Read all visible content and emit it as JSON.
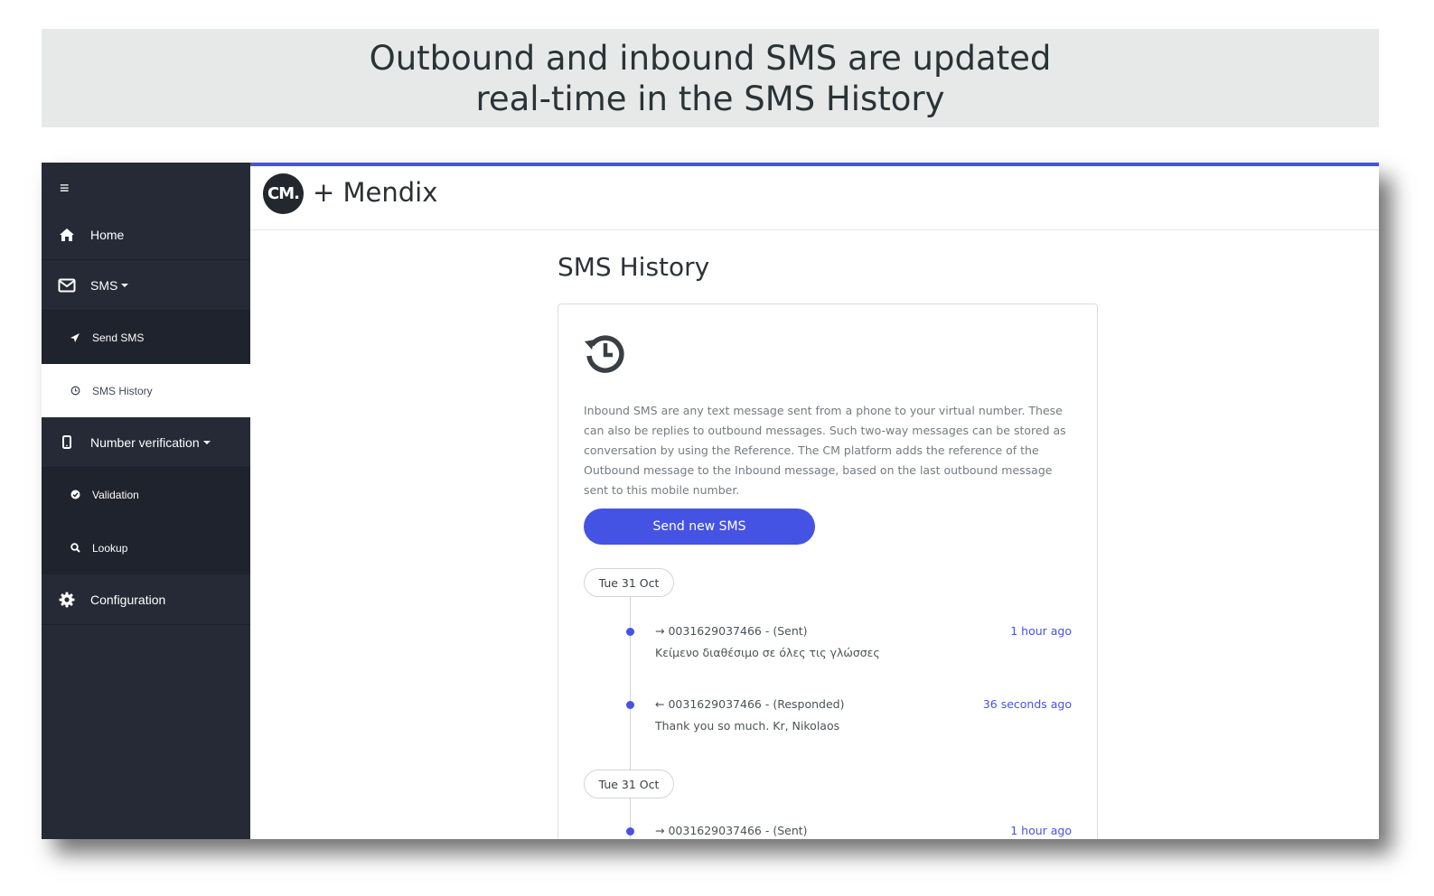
{
  "banner": {
    "line1": "Outbound and inbound SMS are updated",
    "line2": "real-time in the SMS History"
  },
  "colors": {
    "accent": "#4553e4",
    "sidebar_bg": "#252a36",
    "submenu_bg": "#1f232d",
    "link": "#4553e4"
  },
  "sidebar": {
    "menu_icon": "hamburger-icon",
    "items": [
      {
        "label": "Home",
        "icon": "home-icon"
      },
      {
        "label": "SMS",
        "icon": "envelope-icon"
      },
      {
        "label": "Send SMS",
        "icon": "send-icon"
      },
      {
        "label": "SMS History",
        "icon": "clock-icon"
      },
      {
        "label": "Number verification",
        "icon": "mobile-icon"
      },
      {
        "label": "Validation",
        "icon": "check-circle-icon"
      },
      {
        "label": "Lookup",
        "icon": "search-icon"
      },
      {
        "label": "Configuration",
        "icon": "gear-icon"
      }
    ]
  },
  "header": {
    "logo_text": "CM.",
    "brand": "+ Mendix"
  },
  "page": {
    "title": "SMS History",
    "description": "Inbound SMS are any text message sent from a phone to your virtual number. These can also be replies to outbound messages. Such two-way messages can be stored as conversation by using the Reference. The CM platform adds the reference of the Outbound message to the Inbound message, based on the last outbound message sent to this mobile number.",
    "button_label": "Send new SMS",
    "groups": [
      {
        "date": "Tue 31 Oct",
        "entries": [
          {
            "direction": "→",
            "header": "0031629037466 - (Sent)",
            "time": "1 hour ago",
            "message": "Κείμενο διαθέσιμο σε όλες τις γλώσσες"
          },
          {
            "direction": "←",
            "header": "0031629037466 - (Responded)",
            "time": "36 seconds ago",
            "message": "Thank you so much. Kr, Nikolaos"
          }
        ]
      },
      {
        "date": "Tue 31 Oct",
        "entries": [
          {
            "direction": "→",
            "header": "0031629037466 - (Sent)",
            "time": "1 hour ago",
            "message": ""
          }
        ]
      }
    ]
  }
}
